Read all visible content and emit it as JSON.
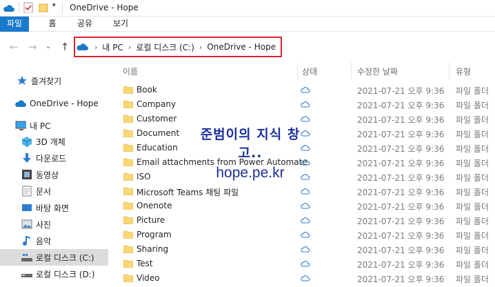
{
  "window": {
    "title": "OneDrive - Hope"
  },
  "ribbon": {
    "tabs": [
      "파일",
      "홈",
      "공유",
      "보기"
    ]
  },
  "address": {
    "segments": [
      "내 PC",
      "로컬 디스크 (C:)",
      "OneDrive - Hope"
    ]
  },
  "nav": {
    "items": [
      {
        "label": "즐겨찾기",
        "icon": "star-icon"
      },
      {
        "label": "OneDrive - Hope",
        "icon": "onedrive-cloud-icon"
      },
      {
        "label": "내 PC",
        "icon": "pc-icon"
      },
      {
        "label": "3D 개체",
        "icon": "cube-3d-icon"
      },
      {
        "label": "다운로드",
        "icon": "download-icon"
      },
      {
        "label": "동영상",
        "icon": "video-icon"
      },
      {
        "label": "문서",
        "icon": "document-icon"
      },
      {
        "label": "바탕 화면",
        "icon": "desktop-icon"
      },
      {
        "label": "사진",
        "icon": "picture-icon"
      },
      {
        "label": "음악",
        "icon": "music-icon"
      },
      {
        "label": "로컬 디스크 (C:)",
        "icon": "drive-icon"
      },
      {
        "label": "로컬 디스크 (D:)",
        "icon": "drive-icon"
      }
    ]
  },
  "columns": {
    "name": "이름",
    "status": "상태",
    "modified": "수정한 날짜",
    "type": "유형"
  },
  "files": [
    {
      "name": "Book",
      "date": "2021-07-21 오후 9:36",
      "type": "파일 폴더"
    },
    {
      "name": "Company",
      "date": "2021-07-21 오후 9:36",
      "type": "파일 폴더"
    },
    {
      "name": "Customer",
      "date": "2021-07-21 오후 9:36",
      "type": "파일 폴더"
    },
    {
      "name": "Document",
      "date": "2021-07-21 오후 9:36",
      "type": "파일 폴더"
    },
    {
      "name": "Education",
      "date": "2021-07-21 오후 9:36",
      "type": "파일 폴더"
    },
    {
      "name": "Email attachments from Power Automate",
      "date": "2021-07-21 오후 9:36",
      "type": "파일 폴더"
    },
    {
      "name": "ISO",
      "date": "2021-07-21 오후 9:36",
      "type": "파일 폴더"
    },
    {
      "name": "Microsoft Teams 채팅 파일",
      "date": "2021-07-21 오후 9:36",
      "type": "파일 폴더"
    },
    {
      "name": "Onenote",
      "date": "2021-07-21 오후 9:36",
      "type": "파일 폴더"
    },
    {
      "name": "Picture",
      "date": "2021-07-21 오후 9:36",
      "type": "파일 폴더"
    },
    {
      "name": "Program",
      "date": "2021-07-21 오후 9:36",
      "type": "파일 폴더"
    },
    {
      "name": "Sharing",
      "date": "2021-07-21 오후 9:36",
      "type": "파일 폴더"
    },
    {
      "name": "Test",
      "date": "2021-07-21 오후 9:36",
      "type": "파일 폴더"
    },
    {
      "name": "Video",
      "date": "2021-07-21 오후 9:36",
      "type": "파일 폴더"
    }
  ],
  "watermark": {
    "line1": "준범이의 지식 창고..",
    "line2": "hope.pe.kr"
  },
  "colors": {
    "accent": "#1979ca",
    "highlight_border": "#d6262b",
    "folder": "#f8d775",
    "cloud": "#2b7cd3",
    "watermark": "#1b2f9a"
  }
}
